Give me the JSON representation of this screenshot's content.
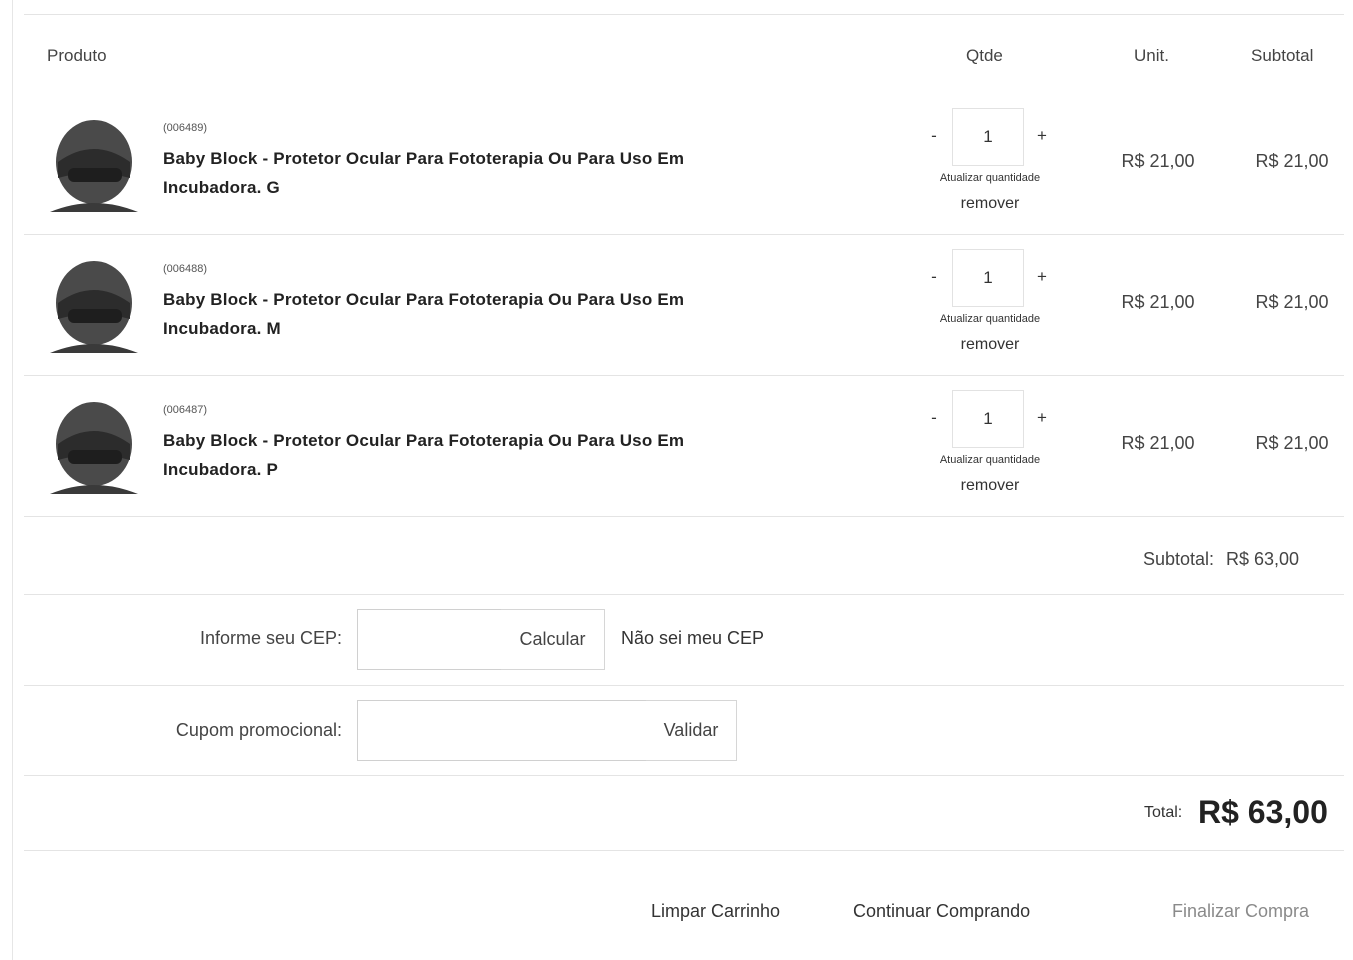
{
  "header": {
    "product": "Produto",
    "qty": "Qtde",
    "unit": "Unit.",
    "subtotal": "Subtotal"
  },
  "items": [
    {
      "code": "(006489)",
      "name_line1": "Baby Block - Protetor Ocular Para Fototerapia Ou Para Uso Em",
      "name_line2": "Incubadora. G",
      "qty": "1",
      "minus": "-",
      "plus": "+",
      "update_label": "Atualizar quantidade",
      "remove_label": "remover",
      "unit_price": "R$ 21,00",
      "subtotal": "R$ 21,00",
      "image_icon": "baby-head-eye-protector"
    },
    {
      "code": "(006488)",
      "name_line1": "Baby Block - Protetor Ocular Para Fototerapia Ou Para Uso Em",
      "name_line2": "Incubadora. M",
      "qty": "1",
      "minus": "-",
      "plus": "+",
      "update_label": "Atualizar quantidade",
      "remove_label": "remover",
      "unit_price": "R$ 21,00",
      "subtotal": "R$ 21,00",
      "image_icon": "baby-head-eye-protector"
    },
    {
      "code": "(006487)",
      "name_line1": "Baby Block - Protetor Ocular Para Fototerapia Ou Para Uso Em",
      "name_line2": "Incubadora. P",
      "qty": "1",
      "minus": "-",
      "plus": "+",
      "update_label": "Atualizar quantidade",
      "remove_label": "remover",
      "unit_price": "R$ 21,00",
      "subtotal": "R$ 21,00",
      "image_icon": "baby-head-eye-protector"
    }
  ],
  "summary": {
    "subtotal_label": "Subtotal:",
    "subtotal_value": "R$ 63,00"
  },
  "shipping": {
    "cep_label": "Informe seu CEP:",
    "cep_value": "",
    "calc_button": "Calcular",
    "unknown_cep_link": "Não sei meu CEP"
  },
  "coupon": {
    "label": "Cupom promocional:",
    "value": "",
    "validate_button": "Validar"
  },
  "total": {
    "label": "Total:",
    "value": "R$ 63,00"
  },
  "actions": {
    "clear_cart": "Limpar Carrinho",
    "continue_shopping": "Continuar Comprando",
    "checkout": "Finalizar Compra"
  },
  "colors": {
    "checkout_text": "#8a8a8a",
    "text": "#444444"
  }
}
